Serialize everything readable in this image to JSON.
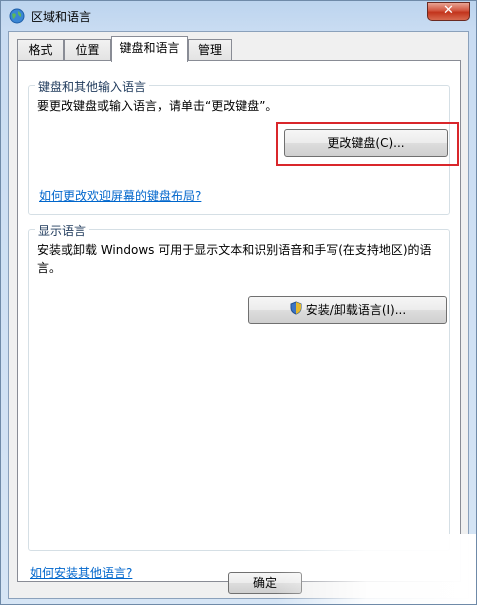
{
  "window": {
    "title": "区域和语言",
    "close_symbol": "✕"
  },
  "tabs": [
    {
      "label": "格式"
    },
    {
      "label": "位置"
    },
    {
      "label": "键盘和语言"
    },
    {
      "label": "管理"
    }
  ],
  "keyboard_group": {
    "label": "键盘和其他输入语言",
    "description": "要更改键盘或输入语言，请单击“更改键盘”。",
    "change_button": "更改键盘(C)...",
    "welcome_link": "如何更改欢迎屏幕的键盘布局?"
  },
  "display_group": {
    "label": "显示语言",
    "description": "安装或卸载 Windows 可用于显示文本和识别语音和手写(在支持地区)的语言。",
    "install_button": "安装/卸载语言(I)..."
  },
  "footer": {
    "help_link": "如何安装其他语言?",
    "ok_button": "确定"
  },
  "colors": {
    "highlight": "#d9262b",
    "link": "#0066cc"
  }
}
